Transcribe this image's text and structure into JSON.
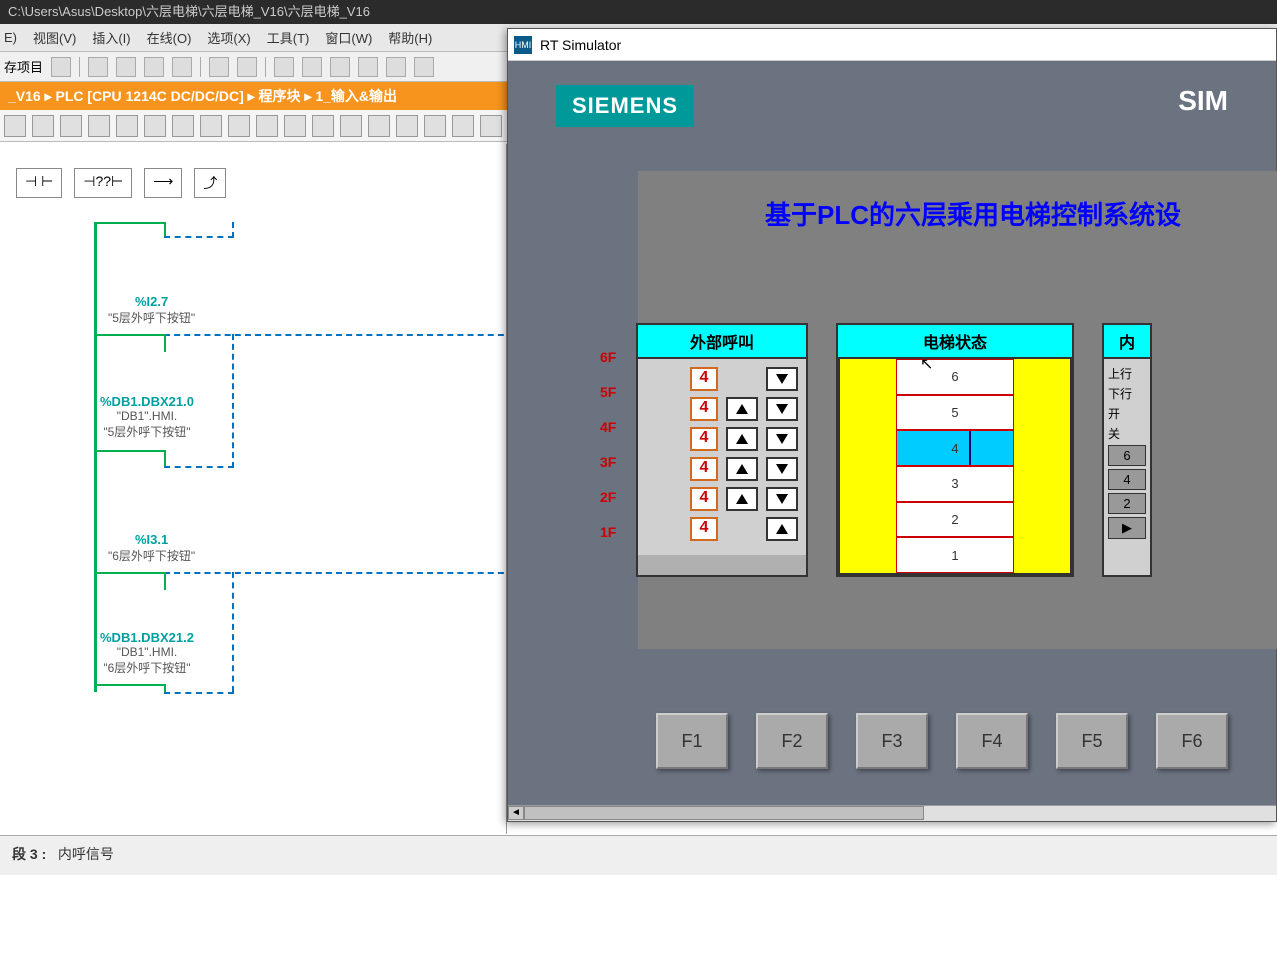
{
  "titlebar": "C:\\Users\\Asus\\Desktop\\六层电梯\\六层电梯_V16\\六层电梯_V16",
  "menu": {
    "edit": "E)",
    "view": "视图(V)",
    "insert": "插入(I)",
    "online": "在线(O)",
    "options": "选项(X)",
    "tools": "工具(T)",
    "window": "窗口(W)",
    "help": "帮助(H)"
  },
  "toolbar": {
    "save": "存项目"
  },
  "breadcrumb": "_V16  ▸  PLC [CPU 1214C DC/DC/DC]  ▸  程序块  ▸  1_输入&输出",
  "ladder_toolbar": {
    "contact": "⊣ ⊢",
    "qmark": "⊣??⊢",
    "line": "⟶",
    "branch": "⤴"
  },
  "rungs": [
    {
      "addr": "%I2.7",
      "desc": "\"5层外呼下按钮\""
    },
    {
      "addr": "%DB1.DBX21.0",
      "prefix": "\"DB1\".HMI.",
      "desc": "\"5层外呼下按钮\""
    },
    {
      "addr": "%I3.1",
      "desc": "\"6层外呼下按钮\""
    },
    {
      "addr": "%DB1.DBX21.2",
      "prefix": "\"DB1\".HMI.",
      "desc": "\"6层外呼下按钮\""
    }
  ],
  "bottom": {
    "seg": "段 3 :",
    "title": "内呼信号"
  },
  "sim": {
    "title": "RT Simulator",
    "icon": "HMI",
    "logo": "SIEMENS",
    "label": "SIM",
    "main_title": "基于PLC的六层乘用电梯控制系统设",
    "panel_call": "外部呼叫",
    "panel_status": "电梯状态",
    "panel_inner": "内",
    "floor_labels": [
      "6F",
      "5F",
      "4F",
      "3F",
      "2F",
      "1F"
    ],
    "current_floor": "4",
    "shaft_floors": [
      "6",
      "5",
      "4",
      "3",
      "2",
      "1"
    ],
    "active_floor": "4",
    "inner_labels": {
      "up": "上行",
      "down": "下行",
      "open": "开",
      "close": "关"
    },
    "inner_buttons": [
      "6",
      "4",
      "2"
    ],
    "fkeys": [
      "F1",
      "F2",
      "F3",
      "F4",
      "F5",
      "F6"
    ]
  }
}
